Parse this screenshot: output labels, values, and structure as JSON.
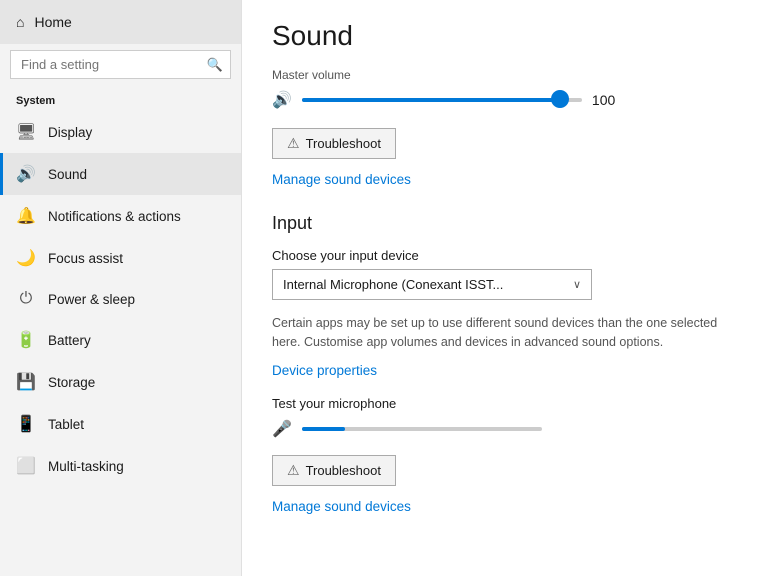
{
  "sidebar": {
    "home_label": "Home",
    "search_placeholder": "Find a setting",
    "system_label": "System",
    "items": [
      {
        "id": "display",
        "label": "Display",
        "icon": "🖥"
      },
      {
        "id": "sound",
        "label": "Sound",
        "icon": "🔊"
      },
      {
        "id": "notifications",
        "label": "Notifications & actions",
        "icon": "🔔"
      },
      {
        "id": "focus",
        "label": "Focus assist",
        "icon": "🌙"
      },
      {
        "id": "power",
        "label": "Power & sleep",
        "icon": "⏻"
      },
      {
        "id": "battery",
        "label": "Battery",
        "icon": "🔋"
      },
      {
        "id": "storage",
        "label": "Storage",
        "icon": "💾"
      },
      {
        "id": "tablet",
        "label": "Tablet",
        "icon": "📱"
      },
      {
        "id": "multitasking",
        "label": "Multi-tasking",
        "icon": "⬜"
      }
    ]
  },
  "main": {
    "page_title": "Sound",
    "master_volume_label": "Master volume",
    "volume_value": "100",
    "troubleshoot_label": "Troubleshoot",
    "manage_sound_devices_label": "Manage sound devices",
    "input_title": "Input",
    "choose_input_label": "Choose your input device",
    "input_device_value": "Internal Microphone (Conexant ISST...",
    "info_text": "Certain apps may be set up to use different sound devices than the one selected here. Customise app volumes and devices in advanced sound options.",
    "device_properties_label": "Device properties",
    "test_mic_label": "Test your microphone",
    "troubleshoot_label2": "Troubleshoot",
    "manage_sound_devices_label2": "Manage sound devices",
    "volume_percent": 92,
    "mic_percent": 18
  },
  "icons": {
    "home": "⌂",
    "search": "🔍",
    "speaker": "🔊",
    "mic": "🎤",
    "warn": "⚠",
    "chevron_down": "∨"
  }
}
